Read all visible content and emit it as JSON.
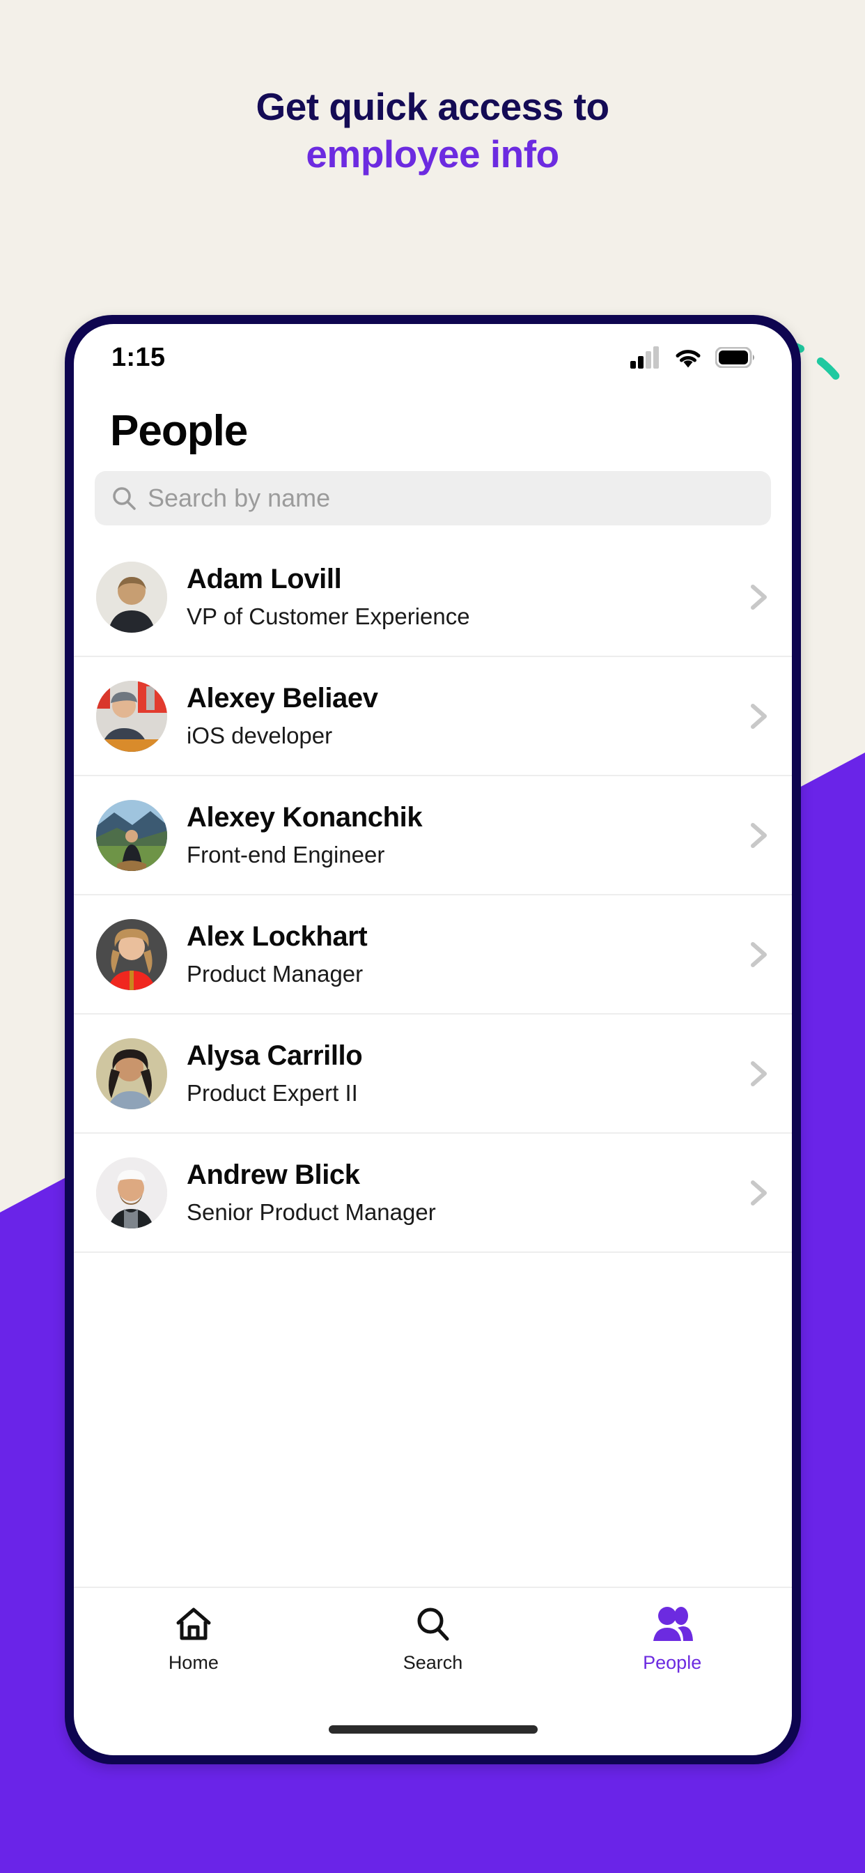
{
  "promo": {
    "headline_line1": "Get quick access to",
    "headline_line2": "employee info",
    "background_color": "#F3F0E9",
    "accent_purple": "#6C2BE0",
    "navy": "#140B55",
    "teal_dash": "#1FC9A0",
    "shape_purple": "#6A24E8"
  },
  "phone": {
    "frame_color": "#0E0550",
    "screen_color": "#FFFFFF"
  },
  "status_bar": {
    "time": "1:15",
    "signal_icon": "cellular-signal-icon",
    "wifi_icon": "wifi-icon",
    "battery_icon": "battery-full-icon"
  },
  "screen": {
    "title": "People",
    "search": {
      "placeholder": "Search by name",
      "value": "",
      "icon": "search-icon"
    },
    "people": [
      {
        "name": "Adam Lovill",
        "role": "VP of Customer Experience",
        "avatar": "avatar-adam-lovill",
        "chevron": "chevron-right-icon"
      },
      {
        "name": "Alexey Beliaev",
        "role": "iOS developer",
        "avatar": "avatar-alexey-beliaev",
        "chevron": "chevron-right-icon"
      },
      {
        "name": "Alexey Konanchik",
        "role": "Front-end Engineer",
        "avatar": "avatar-alexey-konanchik",
        "chevron": "chevron-right-icon"
      },
      {
        "name": "Alex Lockhart",
        "role": "Product Manager",
        "avatar": "avatar-alex-lockhart",
        "chevron": "chevron-right-icon"
      },
      {
        "name": "Alysa Carrillo",
        "role": "Product Expert II",
        "avatar": "avatar-alysa-carrillo",
        "chevron": "chevron-right-icon"
      },
      {
        "name": "Andrew Blick",
        "role": "Senior Product Manager",
        "avatar": "avatar-andrew-blick",
        "chevron": "chevron-right-icon"
      }
    ],
    "tabs": [
      {
        "label": "Home",
        "icon": "home-icon",
        "active": false
      },
      {
        "label": "Search",
        "icon": "search-icon",
        "active": false
      },
      {
        "label": "People",
        "icon": "people-icon",
        "active": true
      }
    ]
  }
}
